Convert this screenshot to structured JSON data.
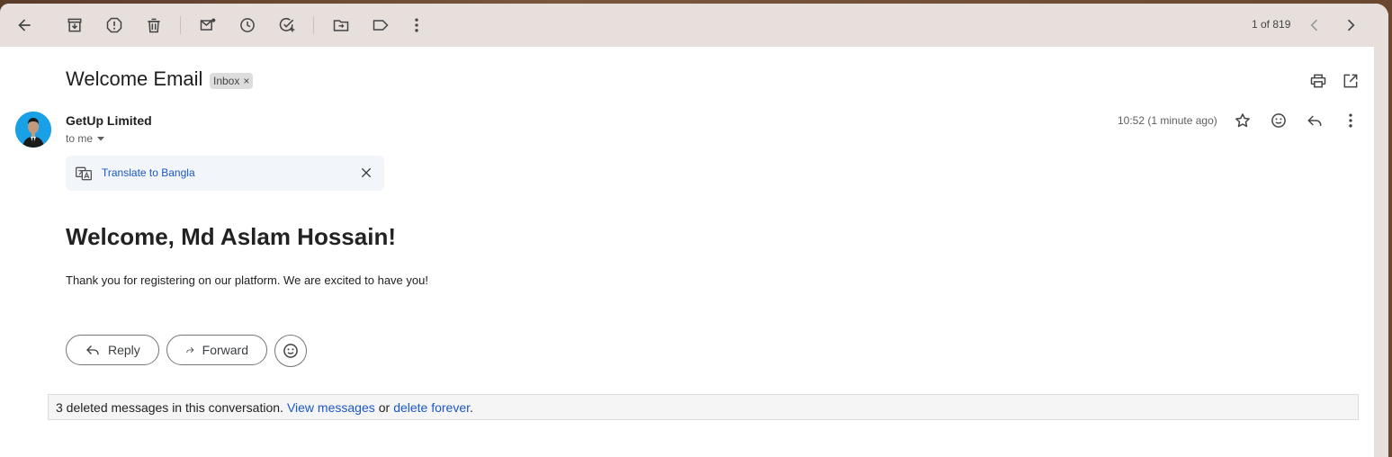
{
  "toolbar": {
    "pager_text": "1 of 819"
  },
  "email": {
    "subject": "Welcome Email",
    "label": "Inbox",
    "label_remove": "×",
    "sender": "GetUp Limited",
    "to": "to me",
    "time": "10:52 (1 minute ago)",
    "translate_link": "Translate to Bangla",
    "heading": "Welcome, Md Aslam Hossain!",
    "body": "Thank you for registering on our platform. We are excited to have you!"
  },
  "actions": {
    "reply": "Reply",
    "forward": "Forward"
  },
  "deleted_notice": {
    "text": "3 deleted messages in this conversation.",
    "view_link": "View messages",
    "or": "or",
    "delete_link": "delete forever",
    "period": "."
  },
  "colors": {
    "toolbar_bg": "#e6dfdc",
    "link": "#1a57c9",
    "avatar_bg": "#1aa0e6"
  }
}
